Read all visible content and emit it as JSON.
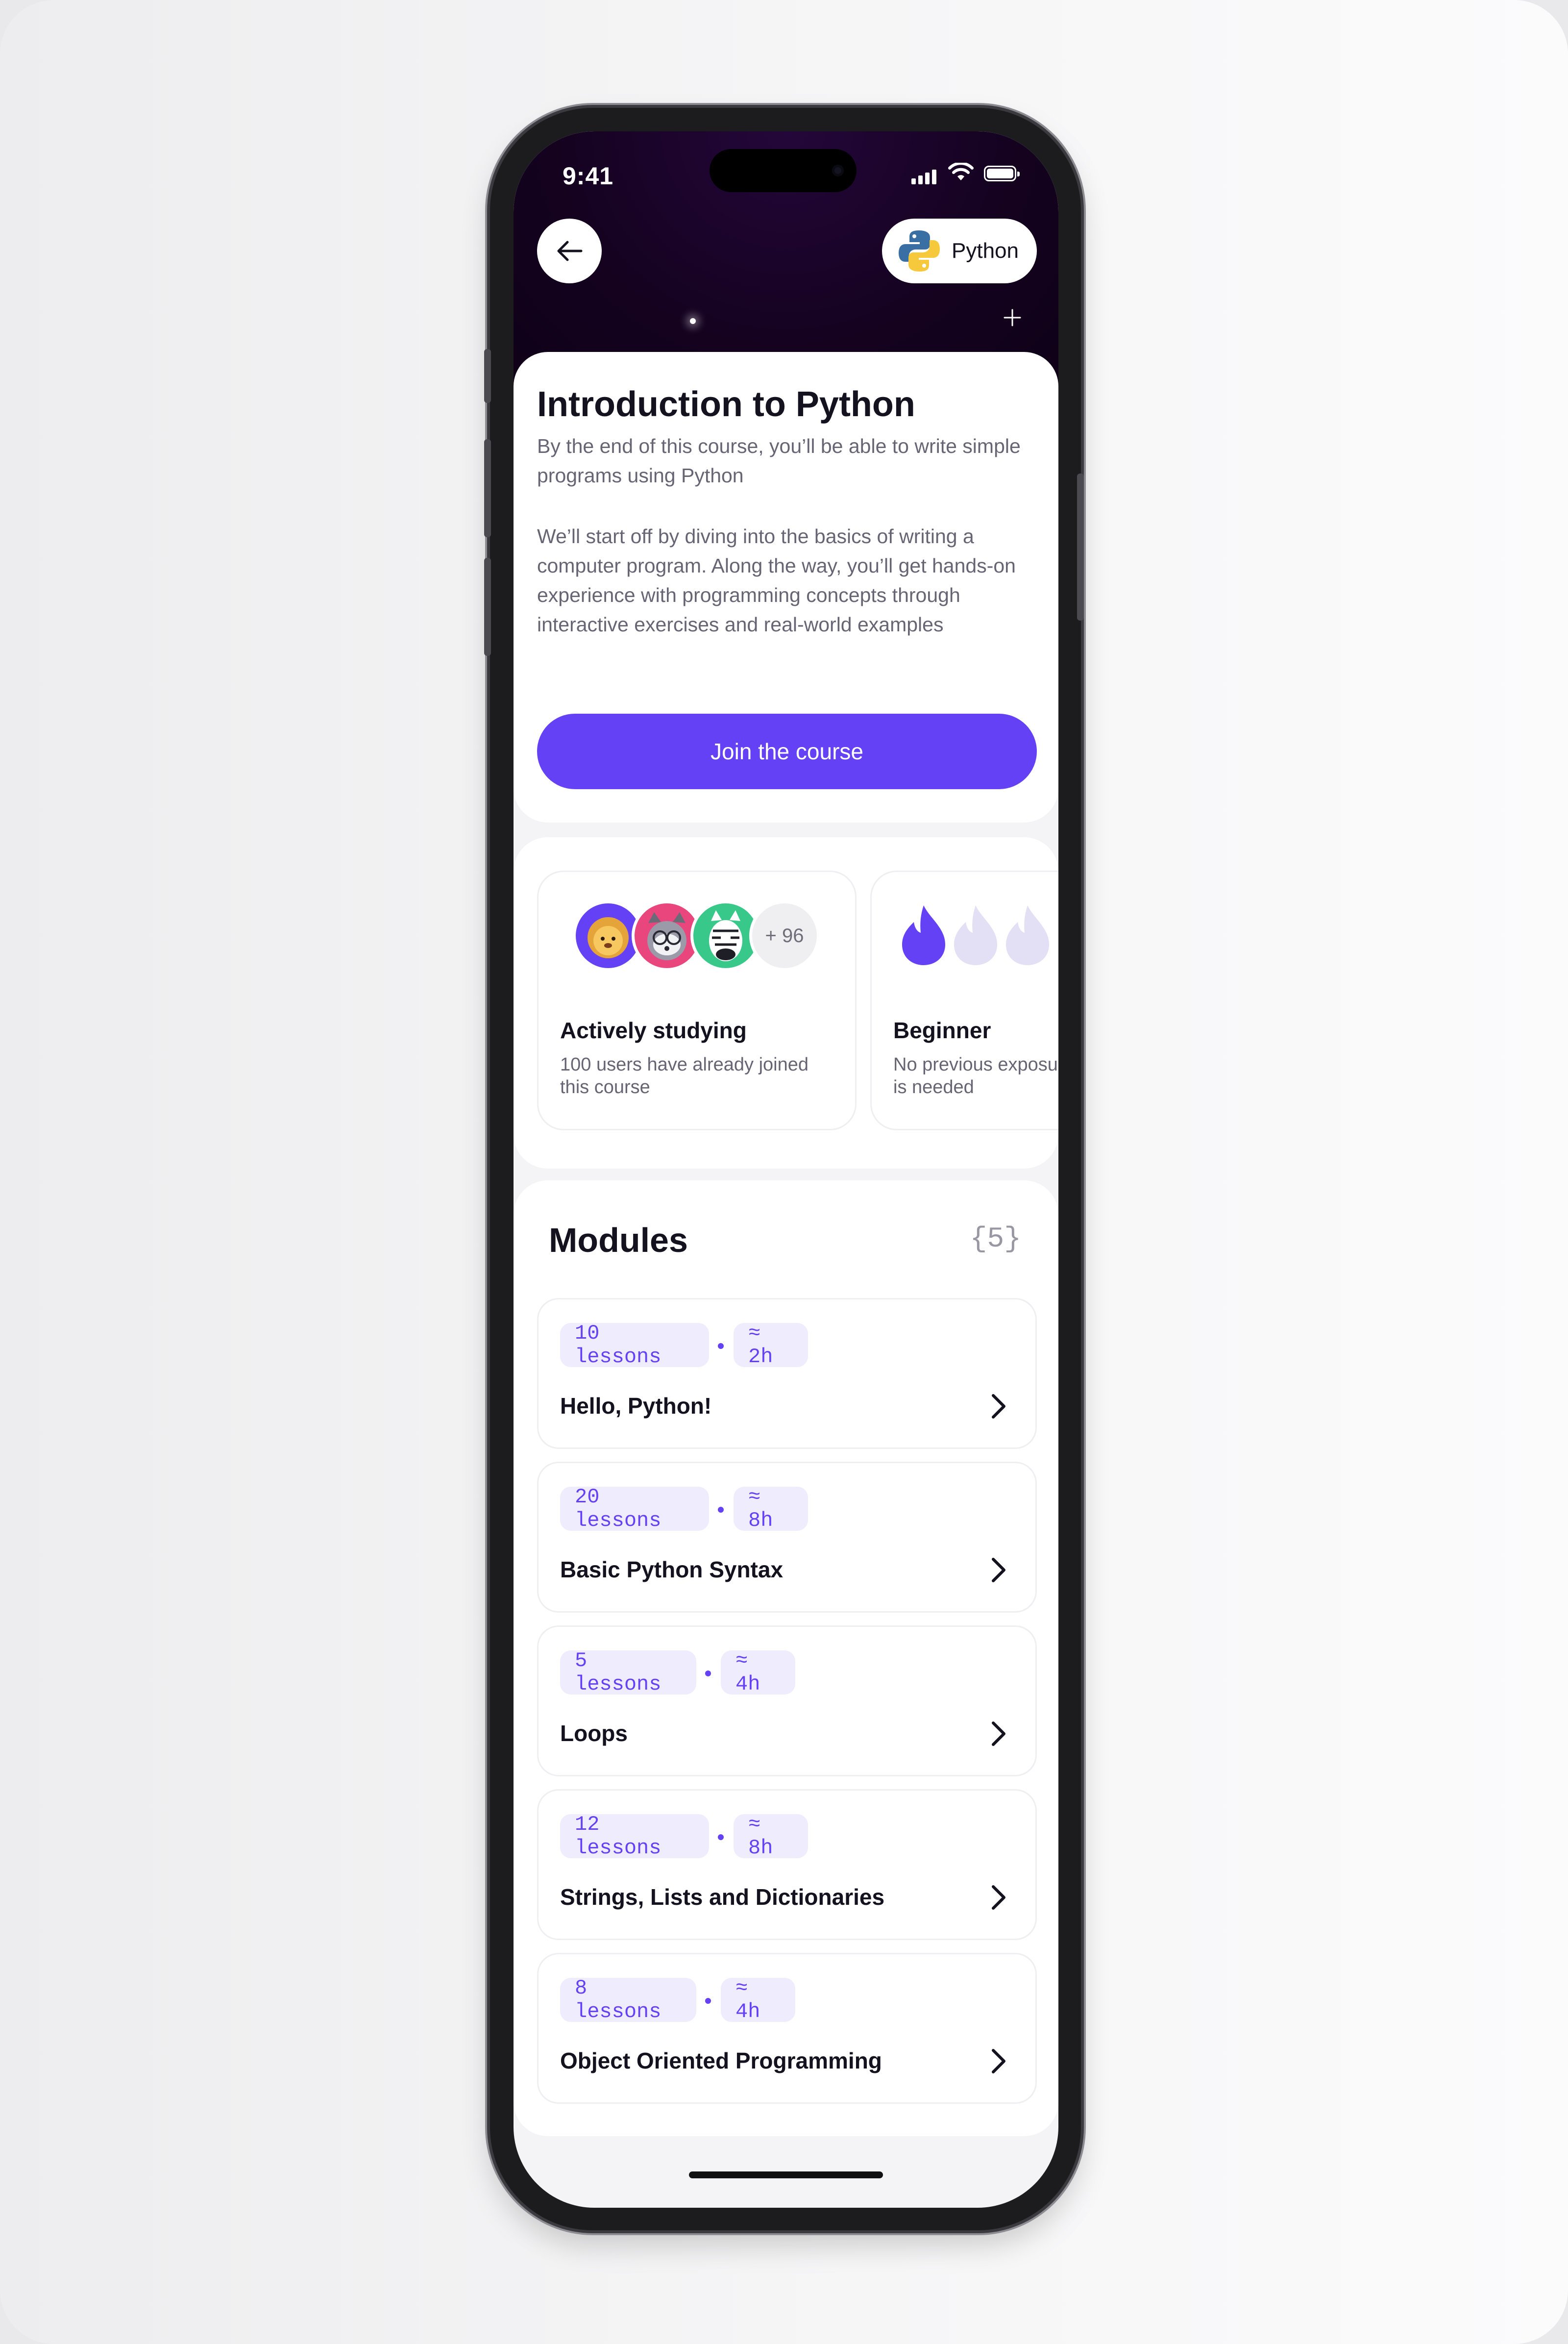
{
  "status_bar": {
    "time": "9:41"
  },
  "header": {
    "language_label": "Python"
  },
  "course": {
    "title": "Introduction to Python",
    "subtitle": "By the end of this course, you’ll be able to write simple programs using Python",
    "description": "We’ll start off by diving into the basics of writing a computer program. Along the way, you’ll get hands-on experience with programming concepts through interactive exercises and real-world examples",
    "join_label": "Join the course"
  },
  "stats": {
    "studying": {
      "more_count": "+ 96",
      "title": "Actively studying",
      "desc_line1": "100 users have already joined",
      "desc_line2": "this course"
    },
    "level": {
      "title": "Beginner",
      "desc_line1": "No previous exposure",
      "desc_line2": "is needed",
      "flames_filled": 1,
      "flames_total": 3
    }
  },
  "modules": {
    "title": "Modules",
    "count": "{5}",
    "items": [
      {
        "lessons": "10 lessons",
        "duration": "≈ 2h",
        "name": "Hello, Python!"
      },
      {
        "lessons": "20 lessons",
        "duration": "≈ 8h",
        "name": "Basic Python Syntax"
      },
      {
        "lessons": "5 lessons",
        "duration": "≈ 4h",
        "name": "Loops"
      },
      {
        "lessons": "12 lessons",
        "duration": "≈ 8h",
        "name": "Strings, Lists and Dictionaries"
      },
      {
        "lessons": "8 lessons",
        "duration": "≈ 4h",
        "name": "Object Oriented Programming"
      }
    ]
  },
  "colors": {
    "accent": "#6541f6",
    "hero_bg": "#14021f",
    "chip_bg": "#efecfd",
    "text_primary": "#15121f",
    "text_secondary": "#676574"
  }
}
